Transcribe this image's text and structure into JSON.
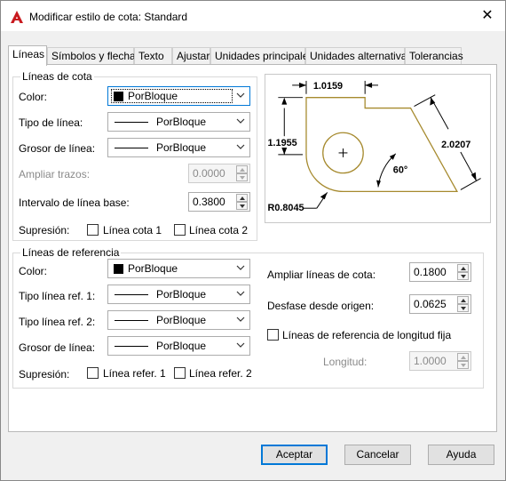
{
  "window": {
    "title": "Modificar estilo de cota: Standard",
    "close": "✕"
  },
  "tabs": [
    "Líneas",
    "Símbolos y flechas",
    "Texto",
    "Ajustar",
    "Unidades principales",
    "Unidades alternativas",
    "Tolerancias"
  ],
  "dim_lines": {
    "title": "Líneas de cota",
    "color_label": "Color:",
    "color_value": "PorBloque",
    "linetype_label": "Tipo de línea:",
    "linetype_value": "PorBloque",
    "lineweight_label": "Grosor de línea:",
    "lineweight_value": "PorBloque",
    "extend_label": "Ampliar trazos:",
    "extend_value": "0.0000",
    "baseline_label": "Intervalo de línea base:",
    "baseline_value": "0.3800",
    "suppress_label": "Supresión:",
    "suppress_1": "Línea cota 1",
    "suppress_2": "Línea cota 2"
  },
  "ext_lines": {
    "title": "Líneas de referencia",
    "color_label": "Color:",
    "color_value": "PorBloque",
    "linetype1_label": "Tipo línea ref. 1:",
    "linetype1_value": "PorBloque",
    "linetype2_label": "Tipo línea ref. 2:",
    "linetype2_value": "PorBloque",
    "lineweight_label": "Grosor de línea:",
    "lineweight_value": "PorBloque",
    "suppress_label": "Supresión:",
    "suppress_1": "Línea refer. 1",
    "suppress_2": "Línea refer. 2",
    "extend_label": "Ampliar líneas de cota:",
    "extend_value": "0.1800",
    "offset_label": "Desfase desde origen:",
    "offset_value": "0.0625",
    "fixed_label": "Líneas de referencia de longitud fija",
    "length_label": "Longitud:",
    "length_value": "1.0000"
  },
  "preview": {
    "dim_top": "1.0159",
    "dim_left": "1.1955",
    "dim_right": "2.0207",
    "angle": "60°",
    "radius": "R0.8045"
  },
  "buttons": {
    "accept": "Aceptar",
    "cancel": "Cancelar",
    "help": "Ayuda"
  },
  "colors": {
    "accent": "#0078d7",
    "app_icon": "#c8191e",
    "preview_geometry": "#a68a2e"
  }
}
